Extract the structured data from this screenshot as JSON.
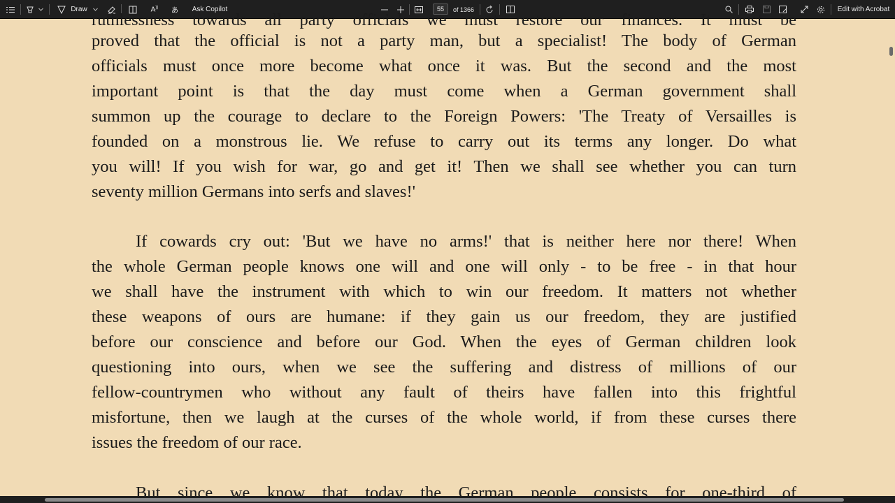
{
  "toolbar": {
    "draw_label": "Draw",
    "copilot_label": "Ask Copilot",
    "page_number": "55",
    "page_total": "of 1366",
    "edit_label": "Edit with Acrobat",
    "icons": [
      "contents-icon",
      "highlight-icon",
      "draw-icon",
      "eraser-icon",
      "view-icon",
      "read-aloud-icon",
      "translate-icon",
      "zoom-out-icon",
      "zoom-in-icon",
      "fit-page-icon",
      "rotate-icon",
      "page-view-icon",
      "search-icon",
      "print-icon",
      "save-icon",
      "save-as-icon",
      "fullscreen-icon",
      "settings-icon"
    ]
  },
  "document": {
    "lines": [
      "ruthlessness towards all party officials we must restore our finances. It must be",
      "proved that the official is not a party man, but a specialist! The body of German",
      "officials must once more become what once it was. But the second and the most",
      "important point is that the day must come when a German government shall",
      "summon up the courage to declare to the Foreign Powers: 'The Treaty of Versailles is",
      "founded on a monstrous lie. We refuse to carry out its terms any longer. Do what",
      "you will! If you wish for war, go and get it! Then we shall see whether you can turn",
      "seventy million Germans into serfs and slaves!'",
      "If cowards cry out: 'But we have no arms!' that is neither here nor there! When",
      "the whole German people knows one will and one will only - to be free - in that hour",
      "we shall have the instrument with which to win our freedom. It matters not whether",
      "these weapons of ours are humane: if they gain us our freedom, they are justified",
      "before our conscience and before our God. When the eyes of German children look",
      "questioning into ours, when we see the suffering and distress of millions of our",
      "fellow-countrymen who without any fault of theirs have fallen into this frightful",
      "misfortune, then we laugh at the curses of the whole world, if from these curses there",
      "issues the freedom of our race.",
      "But since we know that today the German people consists for one-third of"
    ]
  },
  "colors": {
    "page_background": "#f1dbb5",
    "toolbar_background": "#1f1f1f",
    "text": "#1b1b1b"
  }
}
